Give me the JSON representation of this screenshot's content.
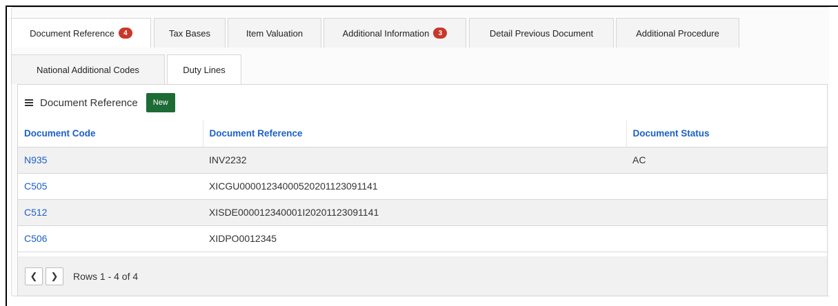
{
  "tabs": [
    {
      "label": "Document Reference",
      "badge": "4",
      "active": true
    },
    {
      "label": "Tax Bases",
      "badge": null
    },
    {
      "label": "Item Valuation",
      "badge": null
    },
    {
      "label": "Additional Information",
      "badge": "3"
    },
    {
      "label": "Detail Previous Document",
      "badge": null
    },
    {
      "label": "Additional Procedure",
      "badge": null
    },
    {
      "label": "National Additional Codes",
      "badge": null
    },
    {
      "label": "Duty Lines",
      "badge": null
    }
  ],
  "panel": {
    "title": "Document Reference",
    "new_label": "New",
    "columns": [
      "Document Code",
      "Document Reference",
      "Document Status"
    ],
    "rows": [
      {
        "code": "N935",
        "reference": "INV2232",
        "status": "AC"
      },
      {
        "code": "C505",
        "reference": "XICGU00001234000520201123091141",
        "status": ""
      },
      {
        "code": "C512",
        "reference": "XISDE000012340001I20201123091141",
        "status": ""
      },
      {
        "code": "C506",
        "reference": "XIDPO0012345",
        "status": ""
      }
    ],
    "pager": {
      "prev_icon": "chevron-left-icon",
      "next_icon": "chevron-right-icon",
      "rows_info": "Rows 1 - 4 of 4"
    }
  },
  "colors": {
    "link": "#1a5fc8",
    "badge": "#c8382b",
    "new_button": "#1d6b35"
  }
}
